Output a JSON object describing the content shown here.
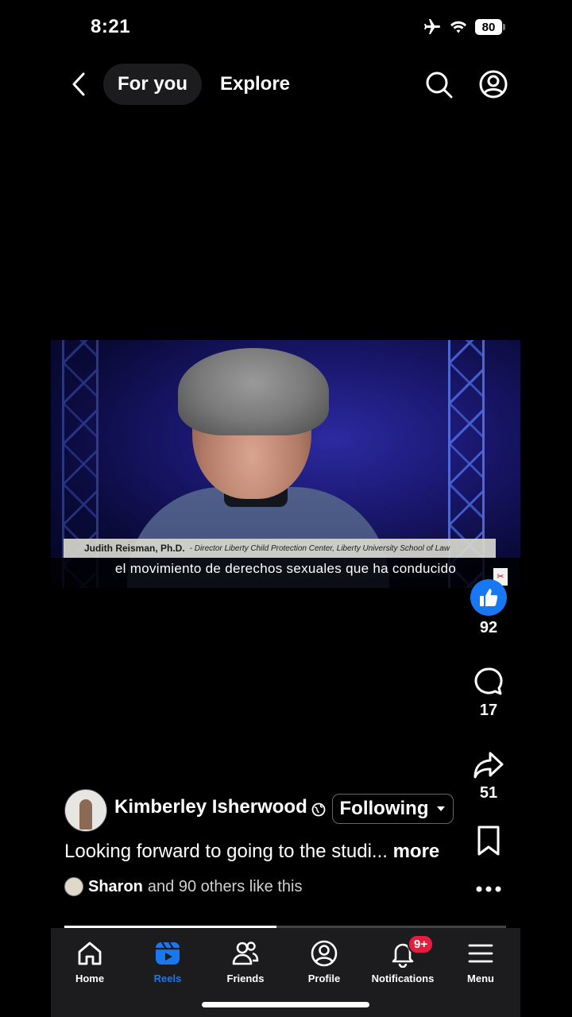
{
  "status": {
    "time": "8:21",
    "battery": "80"
  },
  "topnav": {
    "tab_foryou": "For you",
    "tab_explore": "Explore"
  },
  "video": {
    "lower_third_name": "Judith Reisman, Ph.D.",
    "lower_third_title": "- Director Liberty Child Protection Center, Liberty University School of Law",
    "subtitle": "el movimiento de derechos sexuales que ha conducido"
  },
  "rail": {
    "likes": "92",
    "comments": "17",
    "shares": "51"
  },
  "post": {
    "author": "Kimberley Isherwood",
    "follow_label": "Following",
    "caption": "Looking forward to going to the studi...",
    "more_label": "more",
    "liker_name": "Sharon",
    "likes_text": "and 90 others like this",
    "progress": 0.48
  },
  "bottom_nav": [
    {
      "label": "Home"
    },
    {
      "label": "Reels"
    },
    {
      "label": "Friends"
    },
    {
      "label": "Profile"
    },
    {
      "label": "Notifications",
      "badge": "9+"
    },
    {
      "label": "Menu"
    }
  ],
  "colors": {
    "accent": "#1877f2",
    "badge": "#e41e3f",
    "background": "#000000"
  }
}
